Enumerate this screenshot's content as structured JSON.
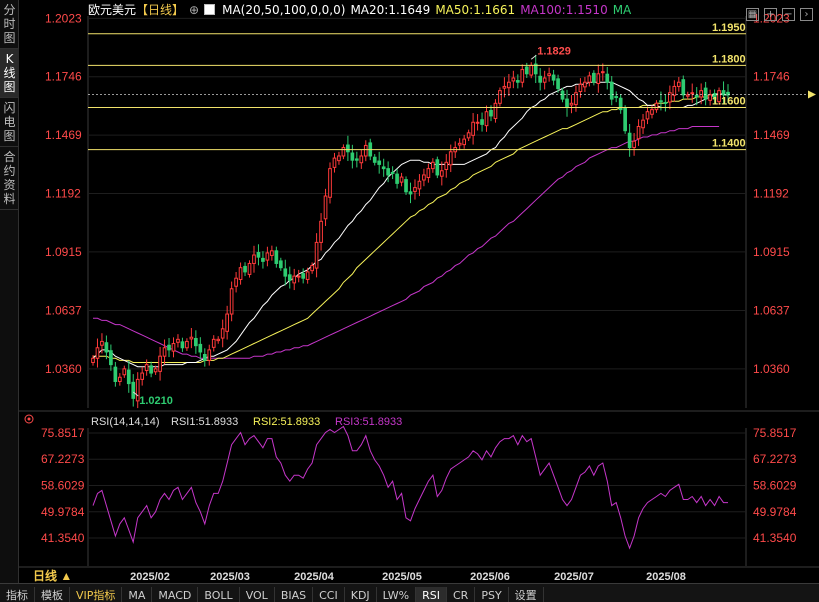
{
  "sidebar": {
    "tabs": [
      {
        "label": "分时图"
      },
      {
        "label": "K线图"
      },
      {
        "label": "闪电图"
      },
      {
        "label": "合约资料"
      }
    ]
  },
  "header": {
    "symbol": "欧元美元",
    "period": "【日线】",
    "ma_def": "MA(20,50,100,0,0,0)",
    "ma20": "MA20:1.1649",
    "ma50": "MA50:1.1661",
    "ma100": "MA100:1.1510",
    "ma_btn": "MA"
  },
  "toolbar_icons": [
    "grid-icon",
    "plus-icon",
    "minus-icon",
    "next-icon"
  ],
  "colors": {
    "up": "#ff3a3a",
    "down": "#2ecc71",
    "ma20": "#ffffff",
    "ma50": "#f7f35a",
    "ma100": "#c536c9",
    "hline": "#f2e36b",
    "axis_text": "#ff4a4a",
    "rsi_line": "#c536c9",
    "label_yellow": "#f2e36b",
    "label_red": "#ff4d4d"
  },
  "price_axis": {
    "ticks": [
      "1.2023",
      "1.1746",
      "1.1469",
      "1.1192",
      "1.0915",
      "1.0637",
      "1.0360"
    ]
  },
  "price_levels": [
    {
      "label": "1.1950",
      "value": 1.195
    },
    {
      "label": "1.1800",
      "value": 1.18
    },
    {
      "label": "1.1600",
      "value": 1.16
    },
    {
      "label": "1.1400",
      "value": 1.14
    }
  ],
  "annotations": {
    "high": "1.1829",
    "low": "1.0210"
  },
  "current_price": 1.1662,
  "rsi": {
    "title": "RSI(14,14,14)",
    "rsi1": "RSI1:51.8933",
    "rsi2": "RSI2:51.8933",
    "rsi3": "RSI3:51.8933",
    "ticks": [
      "75.8517",
      "67.2273",
      "58.6029",
      "49.9784",
      "41.3540"
    ]
  },
  "time_axis": {
    "labels": [
      "2025/02",
      "2025/03",
      "2025/04",
      "2025/05",
      "2025/06",
      "2025/07",
      "2025/08"
    ]
  },
  "period_selector": "日线 ▲",
  "bottom_tabs": [
    {
      "label": "指标",
      "active": false
    },
    {
      "label": "模板",
      "active": false
    },
    {
      "label": "VIP指标",
      "active": false
    },
    {
      "label": "MA",
      "active": false
    },
    {
      "label": "MACD",
      "active": false
    },
    {
      "label": "BOLL",
      "active": false
    },
    {
      "label": "VOL",
      "active": false
    },
    {
      "label": "BIAS",
      "active": false
    },
    {
      "label": "CCI",
      "active": false
    },
    {
      "label": "KDJ",
      "active": false
    },
    {
      "label": "LW%",
      "active": false
    },
    {
      "label": "RSI",
      "active": true
    },
    {
      "label": "CR",
      "active": false
    },
    {
      "label": "PSY",
      "active": false
    },
    {
      "label": "设置",
      "active": false
    }
  ],
  "chart_data": {
    "type": "candlestick",
    "title": "欧元美元【日线】",
    "x_range": [
      "2025/01",
      "2025/08"
    ],
    "ylim": [
      1.015,
      1.205
    ],
    "close": [
      1.041,
      1.046,
      1.049,
      1.044,
      1.038,
      1.03,
      1.032,
      1.036,
      1.029,
      1.022,
      1.031,
      1.034,
      1.038,
      1.034,
      1.036,
      1.042,
      1.046,
      1.045,
      1.048,
      1.05,
      1.046,
      1.049,
      1.051,
      1.047,
      1.044,
      1.04,
      1.045,
      1.05,
      1.05,
      1.055,
      1.062,
      1.074,
      1.079,
      1.084,
      1.082,
      1.086,
      1.09,
      1.089,
      1.087,
      1.091,
      1.092,
      1.086,
      1.084,
      1.08,
      1.078,
      1.08,
      1.08,
      1.079,
      1.082,
      1.085,
      1.096,
      1.106,
      1.118,
      1.131,
      1.136,
      1.137,
      1.141,
      1.139,
      1.135,
      1.135,
      1.137,
      1.142,
      1.137,
      1.134,
      1.133,
      1.131,
      1.128,
      1.129,
      1.124,
      1.127,
      1.12,
      1.119,
      1.122,
      1.125,
      1.128,
      1.131,
      1.134,
      1.128,
      1.13,
      1.134,
      1.139,
      1.141,
      1.143,
      1.145,
      1.148,
      1.153,
      1.153,
      1.152,
      1.158,
      1.156,
      1.162,
      1.168,
      1.17,
      1.172,
      1.174,
      1.172,
      1.178,
      1.176,
      1.18,
      1.176,
      1.172,
      1.174,
      1.176,
      1.173,
      1.169,
      1.164,
      1.16,
      1.162,
      1.167,
      1.171,
      1.172,
      1.175,
      1.172,
      1.176,
      1.177,
      1.172,
      1.164,
      1.165,
      1.159,
      1.149,
      1.141,
      1.144,
      1.151,
      1.154,
      1.158,
      1.159,
      1.162,
      1.163,
      1.162,
      1.167,
      1.17,
      1.172,
      1.166,
      1.166,
      1.167,
      1.165,
      1.168,
      1.164,
      1.166,
      1.164,
      1.168,
      1.166,
      1.166
    ],
    "ma20": [
      1.041,
      1.043,
      1.045,
      1.045,
      1.044,
      1.042,
      1.041,
      1.04,
      1.039,
      1.038,
      1.037,
      1.037,
      1.037,
      1.037,
      1.037,
      1.037,
      1.038,
      1.038,
      1.038,
      1.038,
      1.038,
      1.039,
      1.039,
      1.039,
      1.04,
      1.041,
      1.042,
      1.042,
      1.043,
      1.044,
      1.045,
      1.047,
      1.049,
      1.052,
      1.055,
      1.058,
      1.06,
      1.063,
      1.066,
      1.068,
      1.071,
      1.073,
      1.075,
      1.076,
      1.078,
      1.079,
      1.081,
      1.082,
      1.083,
      1.085,
      1.087,
      1.088,
      1.091,
      1.093,
      1.096,
      1.098,
      1.101,
      1.104,
      1.106,
      1.109,
      1.111,
      1.114,
      1.116,
      1.119,
      1.122,
      1.124,
      1.127,
      1.129,
      1.131,
      1.133,
      1.134,
      1.135,
      1.135,
      1.135,
      1.134,
      1.134,
      1.133,
      1.133,
      1.133,
      1.133,
      1.133,
      1.133,
      1.133,
      1.133,
      1.134,
      1.135,
      1.136,
      1.137,
      1.138,
      1.14,
      1.141,
      1.144,
      1.146,
      1.149,
      1.151,
      1.153,
      1.155,
      1.158,
      1.16,
      1.161,
      1.163,
      1.164,
      1.166,
      1.167,
      1.168,
      1.169,
      1.17,
      1.17,
      1.171,
      1.171,
      1.171,
      1.172,
      1.172,
      1.172,
      1.172,
      1.172,
      1.172,
      1.171,
      1.17,
      1.169,
      1.168,
      1.166,
      1.164,
      1.163,
      1.161,
      1.161,
      1.161,
      1.16,
      1.16,
      1.16,
      1.16,
      1.16,
      1.16,
      1.161,
      1.161,
      1.162,
      1.163,
      1.164,
      1.165,
      1.166,
      1.167,
      1.166,
      1.166
    ],
    "ma50": [
      1.042,
      1.042,
      1.042,
      1.042,
      1.041,
      1.041,
      1.04,
      1.04,
      1.04,
      1.039,
      1.039,
      1.039,
      1.039,
      1.039,
      1.039,
      1.039,
      1.039,
      1.039,
      1.039,
      1.039,
      1.039,
      1.039,
      1.039,
      1.039,
      1.039,
      1.04,
      1.04,
      1.04,
      1.041,
      1.041,
      1.042,
      1.043,
      1.044,
      1.045,
      1.046,
      1.047,
      1.048,
      1.049,
      1.05,
      1.051,
      1.052,
      1.053,
      1.054,
      1.055,
      1.056,
      1.057,
      1.058,
      1.059,
      1.06,
      1.062,
      1.064,
      1.066,
      1.068,
      1.07,
      1.072,
      1.074,
      1.077,
      1.079,
      1.081,
      1.084,
      1.086,
      1.088,
      1.09,
      1.092,
      1.094,
      1.096,
      1.098,
      1.1,
      1.102,
      1.104,
      1.106,
      1.108,
      1.109,
      1.111,
      1.112,
      1.114,
      1.115,
      1.117,
      1.118,
      1.119,
      1.121,
      1.122,
      1.124,
      1.125,
      1.126,
      1.128,
      1.129,
      1.13,
      1.131,
      1.132,
      1.134,
      1.135,
      1.136,
      1.137,
      1.138,
      1.14,
      1.141,
      1.142,
      1.143,
      1.144,
      1.145,
      1.146,
      1.147,
      1.148,
      1.149,
      1.15,
      1.15,
      1.151,
      1.152,
      1.153,
      1.154,
      1.155,
      1.156,
      1.157,
      1.158,
      1.158,
      1.159,
      1.159,
      1.16,
      1.16,
      1.16,
      1.16,
      1.16,
      1.161,
      1.161,
      1.161,
      1.162,
      1.162,
      1.162,
      1.163,
      1.163,
      1.163,
      1.164,
      1.164,
      1.164,
      1.165,
      1.165,
      1.165,
      1.166,
      1.166,
      1.166
    ],
    "ma100": [
      1.06,
      1.06,
      1.059,
      1.059,
      1.058,
      1.057,
      1.057,
      1.056,
      1.055,
      1.054,
      1.053,
      1.052,
      1.051,
      1.05,
      1.049,
      1.048,
      1.047,
      1.046,
      1.045,
      1.044,
      1.043,
      1.043,
      1.042,
      1.042,
      1.041,
      1.041,
      1.041,
      1.041,
      1.041,
      1.041,
      1.041,
      1.041,
      1.041,
      1.041,
      1.041,
      1.041,
      1.042,
      1.042,
      1.042,
      1.043,
      1.043,
      1.044,
      1.044,
      1.045,
      1.045,
      1.046,
      1.046,
      1.047,
      1.047,
      1.048,
      1.049,
      1.05,
      1.051,
      1.052,
      1.053,
      1.054,
      1.055,
      1.056,
      1.057,
      1.058,
      1.059,
      1.06,
      1.061,
      1.062,
      1.063,
      1.064,
      1.065,
      1.066,
      1.067,
      1.068,
      1.069,
      1.071,
      1.072,
      1.073,
      1.075,
      1.076,
      1.077,
      1.079,
      1.08,
      1.082,
      1.083,
      1.085,
      1.086,
      1.088,
      1.09,
      1.091,
      1.093,
      1.094,
      1.096,
      1.098,
      1.099,
      1.101,
      1.103,
      1.105,
      1.106,
      1.108,
      1.11,
      1.112,
      1.114,
      1.116,
      1.118,
      1.12,
      1.122,
      1.124,
      1.126,
      1.127,
      1.129,
      1.13,
      1.132,
      1.133,
      1.134,
      1.136,
      1.137,
      1.138,
      1.139,
      1.14,
      1.141,
      1.141,
      1.142,
      1.143,
      1.144,
      1.144,
      1.145,
      1.146,
      1.146,
      1.147,
      1.147,
      1.148,
      1.148,
      1.149,
      1.149,
      1.15,
      1.15,
      1.15,
      1.151,
      1.151,
      1.151,
      1.151,
      1.151,
      1.151,
      1.151
    ],
    "rsi": [
      52,
      56,
      57,
      52,
      47,
      42,
      46,
      48,
      44,
      40,
      48,
      50,
      52,
      48,
      50,
      54,
      56,
      54,
      57,
      58,
      54,
      56,
      58,
      53,
      50,
      46,
      52,
      56,
      56,
      60,
      66,
      72,
      74,
      76,
      72,
      74,
      75,
      73,
      71,
      74,
      74,
      68,
      66,
      62,
      60,
      62,
      62,
      61,
      64,
      66,
      72,
      74,
      76,
      77,
      76,
      77,
      78,
      75,
      70,
      70,
      72,
      75,
      70,
      67,
      65,
      62,
      58,
      60,
      54,
      56,
      48,
      47,
      51,
      54,
      57,
      60,
      62,
      55,
      57,
      61,
      64,
      65,
      66,
      67,
      68,
      70,
      69,
      67,
      70,
      68,
      71,
      73,
      74,
      74,
      75,
      72,
      75,
      73,
      74,
      68,
      62,
      64,
      66,
      62,
      58,
      54,
      52,
      54,
      58,
      62,
      63,
      65,
      62,
      65,
      66,
      60,
      52,
      53,
      48,
      42,
      38,
      42,
      48,
      51,
      53,
      54,
      55,
      56,
      55,
      57,
      58,
      59,
      54,
      54,
      55,
      53,
      55,
      52,
      54,
      52,
      55,
      53,
      53
    ]
  }
}
